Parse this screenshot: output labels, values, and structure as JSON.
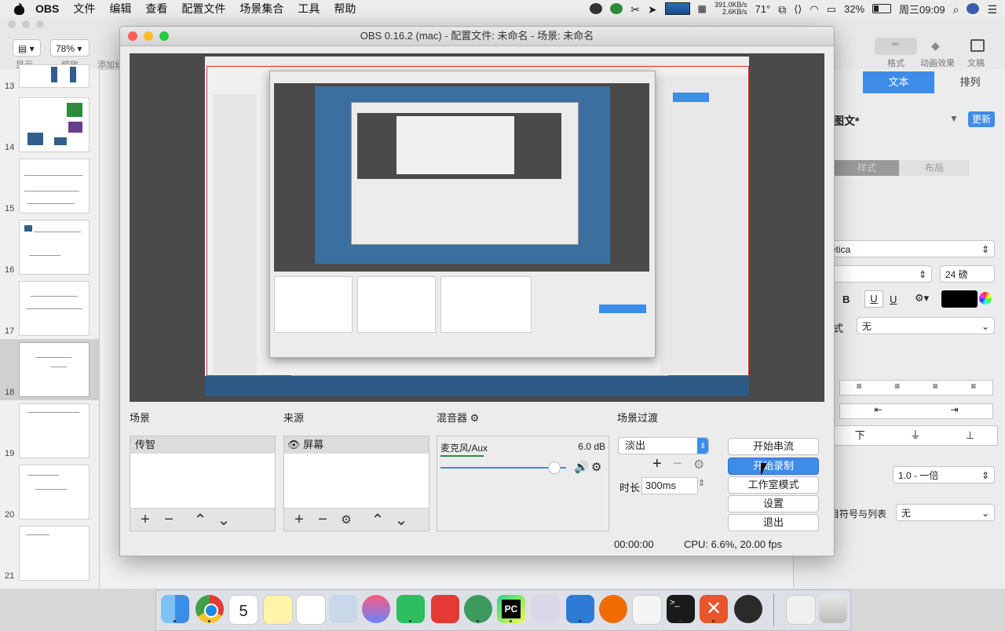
{
  "menubar": {
    "app": "OBS",
    "items": [
      "文件",
      "编辑",
      "查看",
      "配置文件",
      "场景集合",
      "工具",
      "帮助"
    ],
    "net_up": "391.0KB/s",
    "net_down": "2.6KB/s",
    "temperature": "71°",
    "battery": "32%",
    "clock": "周三09:09"
  },
  "keynote": {
    "toolbar": {
      "view_label": "显示",
      "zoom_value": "78%",
      "zoom_label": "缩放",
      "add_label": "添加幻",
      "format_label": "格式",
      "animate_label": "动画效果",
      "document_label": "文稿"
    },
    "slide_numbers": [
      "13",
      "14",
      "15",
      "16",
      "17",
      "18",
      "19",
      "20",
      "21"
    ],
    "panel": {
      "tab_text": "文本",
      "tab_arrange": "排列",
      "style_name": "图文*",
      "update_button": "更新",
      "style_tab": "样式",
      "layout_tab": "布局",
      "font_name": "etica",
      "font_size": "24 磅",
      "bold": "B",
      "underline": "U",
      "bullets_label": "式",
      "bullets_value": "无",
      "spacing_value": "1.0 - 一倍",
      "bullets_list_label": "目符号与列表",
      "bullets_list_value": "无",
      "top_label": "下"
    }
  },
  "obs": {
    "title": "OBS 0.16.2 (mac) - 配置文件: 未命名 - 场景: 未命名",
    "scenes_title": "场景",
    "scenes": [
      "传智"
    ],
    "sources_title": "来源",
    "sources": [
      "屏幕"
    ],
    "mixer_title": "混音器",
    "mixer_channel": "麦克风/Aux",
    "mixer_level": "6.0 dB",
    "mixer_volume": 0.9,
    "transition_title": "场景过渡",
    "transition_value": "淡出",
    "duration_label": "时长",
    "duration_value": "300ms",
    "buttons": [
      "开始串流",
      "开始录制",
      "工作室模式",
      "设置",
      "退出"
    ],
    "status_time": "00:00:00",
    "status_cpu": "CPU: 6.6%, 20.00 fps"
  },
  "dock": {
    "calendar_day": "5",
    "apps": [
      "finder-icon",
      "chrome-icon",
      "calendar-icon",
      "notes-icon",
      "reminders-icon",
      "preview-icon",
      "itunes-icon",
      "evernote-icon",
      "git-icon",
      "atom-icon",
      "pycharm-icon",
      "brushes-icon",
      "keynote-icon",
      "postman-icon",
      "textedit-icon",
      "terminal-icon",
      "xmind-icon",
      "obs-icon",
      "document-icon",
      "trash-icon"
    ]
  },
  "colors": {
    "accent_blue": "#3d8ce8",
    "preview_border": "#e03030"
  }
}
